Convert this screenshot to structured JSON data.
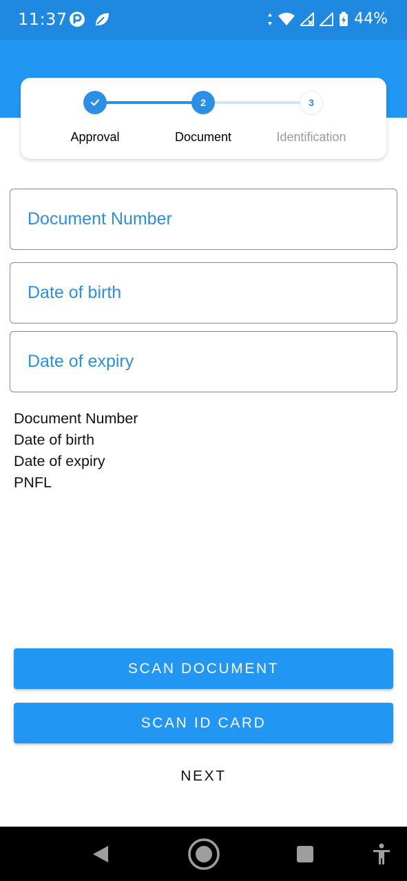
{
  "status_bar": {
    "time": "11:37",
    "battery": "44%",
    "icons": [
      "app-notification-icon",
      "leaf-icon",
      "data-arrows-icon",
      "wifi-icon",
      "signal-icon",
      "signal-icon",
      "battery-icon"
    ]
  },
  "stepper": {
    "steps": [
      {
        "number": "✓",
        "label": "Approval",
        "state": "done"
      },
      {
        "number": "2",
        "label": "Document",
        "state": "active"
      },
      {
        "number": "3",
        "label": "Identification",
        "state": "pending"
      }
    ]
  },
  "form": {
    "document_number": {
      "placeholder": "Document Number",
      "value": ""
    },
    "date_of_birth": {
      "placeholder": "Date of birth",
      "value": ""
    },
    "date_of_expiry": {
      "placeholder": "Date of expiry",
      "value": ""
    }
  },
  "info_lines": [
    "Document Number",
    "Date of birth",
    "Date of expiry",
    "PNFL"
  ],
  "actions": {
    "scan_document": "SCAN DOCUMENT",
    "scan_id_card": "SCAN ID CARD",
    "next": "NEXT"
  },
  "nav_bar": {
    "items": [
      "back-icon",
      "home-icon",
      "recents-icon",
      "accessibility-icon"
    ]
  },
  "colors": {
    "primary": "#2196f3",
    "status_bar": "#1f88e0",
    "field_text": "#2e8fd9"
  }
}
